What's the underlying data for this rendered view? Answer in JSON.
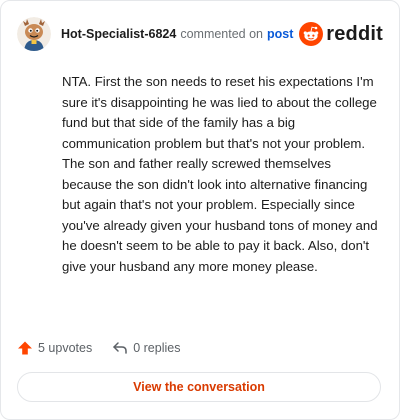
{
  "comment": {
    "username": "Hot-Specialist-6824",
    "action_text": "commented on",
    "post_link": "post",
    "body": "NTA. First the son needs to reset his expectations I'm sure it's disappointing he was lied to about the college fund but that side of the family has a big communication problem but that's not your problem. The son and father really screwed themselves because the son didn't look into alternative financing but again that's not your problem. Especially since you've already given your husband tons of money and he doesn't seem to be able to pay it back. Also, don't give your husband any more money please."
  },
  "brand": {
    "wordmark": "reddit",
    "icon": "reddit-snoo-icon",
    "accent": "#ff4500"
  },
  "actions": {
    "upvotes_label": "5 upvotes",
    "upvote_icon": "upvote-arrow-icon",
    "upvote_color": "#ff4500",
    "replies_label": "0 replies",
    "reply_icon": "reply-arrow-icon"
  },
  "cta": {
    "label": "View the conversation",
    "color": "#d93a00"
  }
}
